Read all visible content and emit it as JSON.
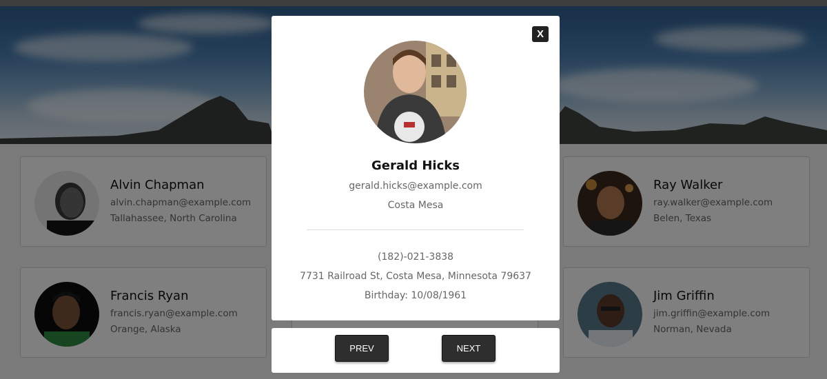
{
  "employees": [
    {
      "name": "Alvin Chapman",
      "email": "alvin.chapman@example.com",
      "location": "Tallahassee, North Carolina"
    },
    {
      "name": "Ray Walker",
      "email": "ray.walker@example.com",
      "location": "Belen, Texas"
    },
    {
      "name": "Francis Ryan",
      "email": "francis.ryan@example.com",
      "location": "Orange, Alaska"
    },
    {
      "name": "Jim Griffin",
      "email": "jim.griffin@example.com",
      "location": "Norman, Nevada"
    }
  ],
  "modal": {
    "close_label": "X",
    "name": "Gerald Hicks",
    "email": "gerald.hicks@example.com",
    "city": "Costa Mesa",
    "phone": "(182)-021-3838",
    "address": "7731 Railroad St, Costa Mesa, Minnesota 79637",
    "birthday": "Birthday: 10/08/1961"
  },
  "nav": {
    "prev_label": "PREV",
    "next_label": "NEXT"
  },
  "colors": {
    "overlay": "rgba(0,0,0,0.5)",
    "button": "#2e2e2e",
    "card_border": "#d4d4d4"
  }
}
